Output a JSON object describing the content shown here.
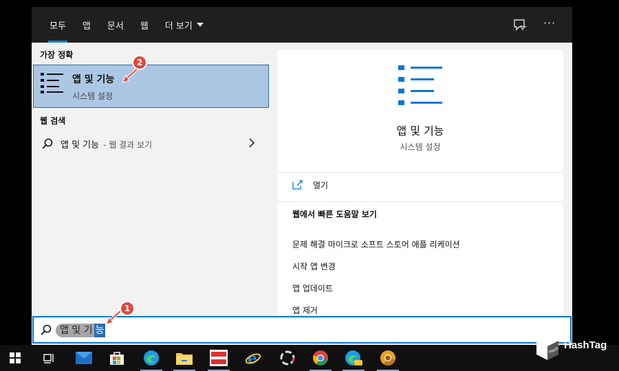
{
  "tabs": [
    {
      "label": "모두",
      "active": true
    },
    {
      "label": "앱"
    },
    {
      "label": "문서"
    },
    {
      "label": "웹"
    },
    {
      "label": "더 보기"
    }
  ],
  "icons": {
    "feedback": "feedback-icon",
    "more": "more-options-icon",
    "more_glyph": "···"
  },
  "sections": {
    "best_match": "가장 정확",
    "web_search": "웹 검색"
  },
  "best_match": {
    "title": "앱 및 기능",
    "subtitle": "시스템 설정"
  },
  "web_result": {
    "query": "앱 및 기능",
    "hint": "- 웹 결과 보기"
  },
  "preview": {
    "title": "앱 및 기능",
    "subtitle": "시스템 설정",
    "open_label": "열기",
    "help_title": "웹에서 빠른 도움말 보기",
    "help_links": [
      "문제 해결 마이크로 소프트 스토어 애플 리케이션",
      "시작 앱 변경",
      "앱 업데이트",
      "앱 제거"
    ]
  },
  "search": {
    "text_gray": "앱 및 기",
    "text_selected": "능"
  },
  "annotations": [
    "1",
    "2"
  ],
  "taskbar": [
    "windows-start-icon",
    "task-view-icon",
    "mail-icon",
    "store-icon",
    "edge-icon",
    "file-explorer-icon",
    "app-icon",
    "internet-explorer-icon",
    "loader-app-icon",
    "chrome-icon",
    "edge-canary-icon",
    "chrome-canary-icon"
  ],
  "watermark": {
    "text": "HashTag",
    "cube_text": "Hash Tag"
  },
  "colors": {
    "accent": "#0a78d7",
    "selection": "#acc7e4",
    "badge": "#e04a3c",
    "topbar": "#1f1f1f"
  }
}
